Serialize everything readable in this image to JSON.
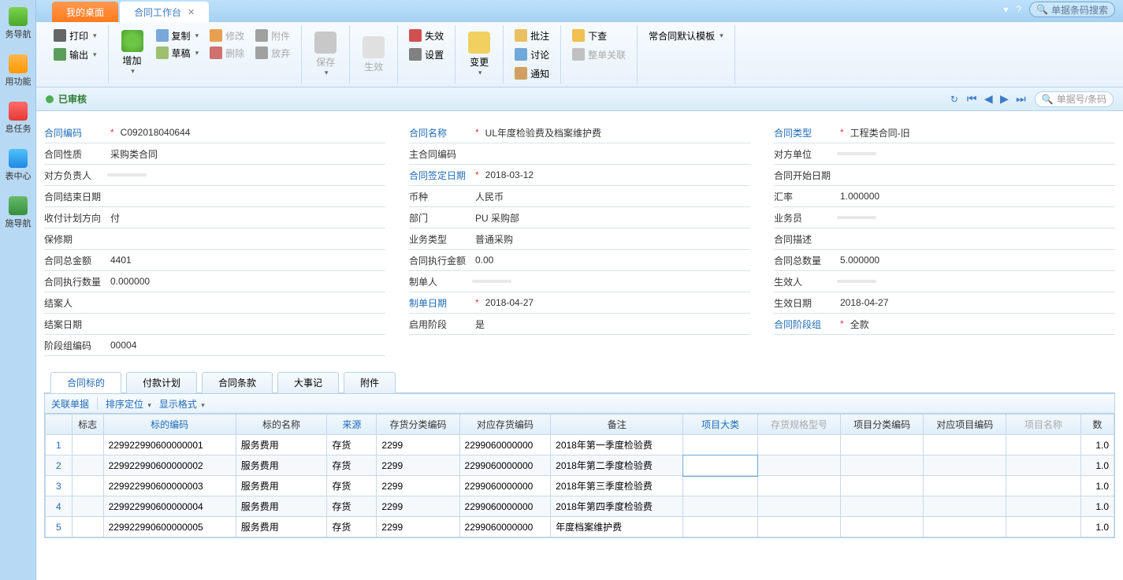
{
  "sidebar": {
    "items": [
      {
        "label": "务导航"
      },
      {
        "label": "用功能"
      },
      {
        "label": "息任务"
      },
      {
        "label": "表中心"
      },
      {
        "label": "施导航"
      }
    ]
  },
  "tabs": {
    "inactive": "我的桌面",
    "active": "合同工作台"
  },
  "top_search_placeholder": "单据条码搜索",
  "ribbon": {
    "print": "打印",
    "export": "输出",
    "add": "增加",
    "copy": "复制",
    "draft": "草稿",
    "edit": "修改",
    "delete": "删除",
    "attach": "附件",
    "discard": "放弃",
    "save": "保存",
    "effect": "生效",
    "void": "失效",
    "settings": "设置",
    "change": "变更",
    "note": "批注",
    "discuss": "讨论",
    "notify": "通知",
    "down_check": "下查",
    "link_batch": "整单关联",
    "template": "常合同默认模板"
  },
  "status": {
    "label": "已审核",
    "search_placeholder": "单据号/条码"
  },
  "form": {
    "contract_code": {
      "label": "合同编码",
      "value": "C092018040644"
    },
    "contract_name": {
      "label": "合同名称",
      "value": "UL年度检验费及档案维护费"
    },
    "contract_type": {
      "label": "合同类型",
      "value": "工程类合同-旧"
    },
    "contract_nature": {
      "label": "合同性质",
      "value": "采购类合同"
    },
    "main_contract_code": {
      "label": "主合同编码",
      "value": ""
    },
    "other_party": {
      "label": "对方单位",
      "value": ""
    },
    "other_party_person": {
      "label": "对方负责人",
      "value": ""
    },
    "sign_date": {
      "label": "合同签定日期",
      "value": "2018-03-12"
    },
    "start_date": {
      "label": "合同开始日期",
      "value": ""
    },
    "end_date": {
      "label": "合同结束日期",
      "value": ""
    },
    "currency": {
      "label": "币种",
      "value": "人民币"
    },
    "rate": {
      "label": "汇率",
      "value": "1.000000"
    },
    "pay_direction": {
      "label": "收付计划方向",
      "value": "付"
    },
    "department": {
      "label": "部门",
      "value": "PU 采购部"
    },
    "salesman": {
      "label": "业务员",
      "value": ""
    },
    "warranty": {
      "label": "保修期",
      "value": ""
    },
    "biz_type": {
      "label": "业务类型",
      "value": "普通采购"
    },
    "desc": {
      "label": "合同描述",
      "value": ""
    },
    "total_amount": {
      "label": "合同总金额",
      "value": "4401"
    },
    "exec_amount": {
      "label": "合同执行金额",
      "value": "0.00"
    },
    "total_qty": {
      "label": "合同总数量",
      "value": "5.000000"
    },
    "exec_qty": {
      "label": "合同执行数量",
      "value": "0.000000"
    },
    "maker": {
      "label": "制单人",
      "value": ""
    },
    "effector": {
      "label": "生效人",
      "value": ""
    },
    "closer": {
      "label": "结案人",
      "value": ""
    },
    "make_date": {
      "label": "制单日期",
      "value": "2018-04-27"
    },
    "effect_date": {
      "label": "生效日期",
      "value": "2018-04-27"
    },
    "close_date": {
      "label": "结案日期",
      "value": ""
    },
    "enable_stage": {
      "label": "启用阶段",
      "value": "是"
    },
    "stage_group": {
      "label": "合同阶段组",
      "value": "全款"
    },
    "stage_code": {
      "label": "阶段组编码",
      "value": "00004"
    }
  },
  "detail_tabs": [
    "合同标的",
    "付款计划",
    "合同条款",
    "大事记",
    "附件"
  ],
  "detail_toolbar": {
    "link_doc": "关联单据",
    "sort": "排序定位",
    "display": "显示格式"
  },
  "table": {
    "columns": [
      "",
      "标志",
      "标的编码",
      "标的名称",
      "来源",
      "存货分类编码",
      "对应存货编码",
      "备注",
      "项目大类",
      "存货规格型号",
      "项目分类编码",
      "对应项目编码",
      "项目名称",
      "数"
    ],
    "rows": [
      {
        "n": "1",
        "code": "229922990600000001",
        "name": "服务费用",
        "src": "存货",
        "cat": "2299",
        "inv": "2299060000000",
        "remark": "2018年第一季度检验费",
        "qty": "1.0"
      },
      {
        "n": "2",
        "code": "229922990600000002",
        "name": "服务费用",
        "src": "存货",
        "cat": "2299",
        "inv": "2299060000000",
        "remark": "2018年第二季度检验费",
        "qty": "1.0"
      },
      {
        "n": "3",
        "code": "229922990600000003",
        "name": "服务费用",
        "src": "存货",
        "cat": "2299",
        "inv": "2299060000000",
        "remark": "2018年第三季度检验费",
        "qty": "1.0"
      },
      {
        "n": "4",
        "code": "229922990600000004",
        "name": "服务费用",
        "src": "存货",
        "cat": "2299",
        "inv": "2299060000000",
        "remark": "2018年第四季度检验费",
        "qty": "1.0"
      },
      {
        "n": "5",
        "code": "229922990600000005",
        "name": "服务费用",
        "src": "存货",
        "cat": "2299",
        "inv": "2299060000000",
        "remark": "年度档案维护费",
        "qty": "1.0"
      }
    ]
  }
}
